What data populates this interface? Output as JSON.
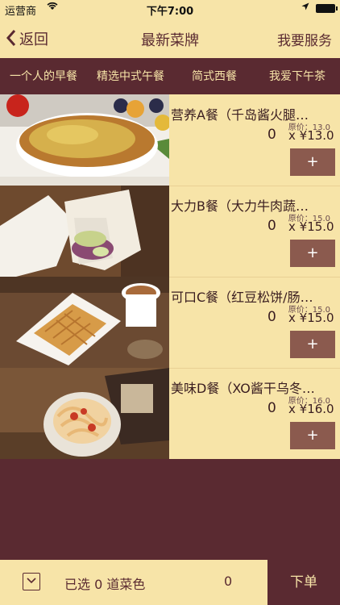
{
  "status_bar": {
    "carrier": "运营商",
    "time": "下午7:00"
  },
  "nav": {
    "back_label": "返回",
    "title": "最新菜牌",
    "service_label": "我要服务"
  },
  "tabs": [
    "一个人的早餐",
    "精选中式午餐",
    "简式西餐",
    "我爱下午茶"
  ],
  "items": [
    {
      "name": "营养A餐（千岛酱火腿…",
      "original_price": "原价：13.0",
      "quantity": "0",
      "price": "x ¥13.0",
      "add_label": "+"
    },
    {
      "name": "大力B餐（大力牛肉蔬…",
      "original_price": "原价：15.0",
      "quantity": "0",
      "price": "x ¥15.0",
      "add_label": "+"
    },
    {
      "name": "可口C餐（红豆松饼/肠…",
      "original_price": "原价：15.0",
      "quantity": "0",
      "price": "x ¥15.0",
      "add_label": "+"
    },
    {
      "name": "美味D餐（XO酱干乌冬…",
      "original_price": "原价：16.0",
      "quantity": "0",
      "price": "x ¥16.0",
      "add_label": "+"
    }
  ],
  "bottom": {
    "selected_text": "已选 0 道菜色",
    "total": "0",
    "order_label": "下单"
  },
  "colors": {
    "cream": "#f7e4a8",
    "maroon": "#5a2a31",
    "button": "#8b5a4e"
  }
}
